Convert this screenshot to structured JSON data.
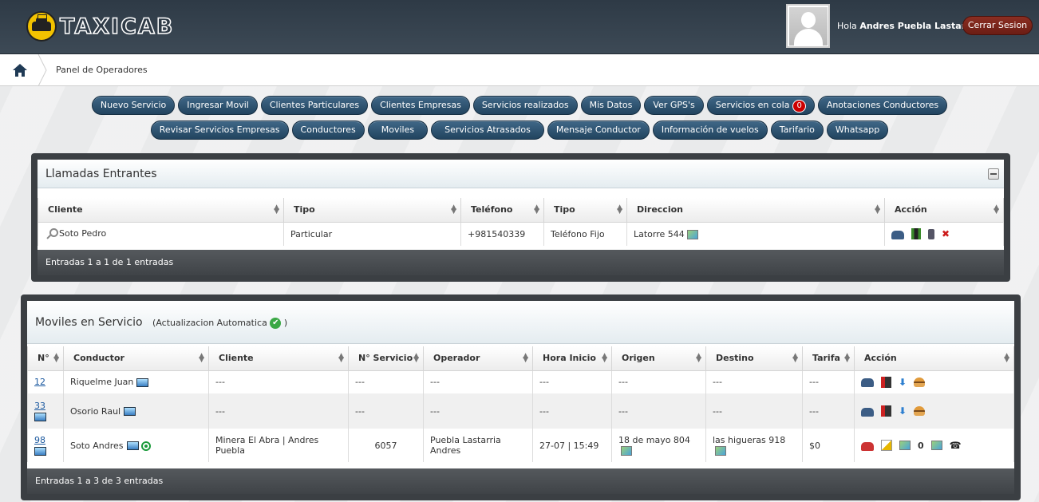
{
  "header": {
    "logo_text": "TAXICAB",
    "greeting_prefix": "Hola",
    "user_name": "Andres Puebla Lastarria",
    "logout_label": "Cerrar Sesion"
  },
  "breadcrumb": {
    "current": "Panel de Operadores"
  },
  "nav": {
    "row1": [
      "Nuevo Servicio",
      "Ingresar Movil",
      "Clientes Particulares",
      "Clientes Empresas",
      "Servicios realizados",
      "Mis Datos",
      "Ver GPS's",
      "Servicios en cola",
      "Anotaciones Conductores"
    ],
    "queue_count": "0",
    "row2": [
      "Revisar Servicios Empresas",
      "Conductores",
      "Moviles",
      "Servicios Atrasados",
      "Mensaje Conductor",
      "Información de vuelos",
      "Tarifario",
      "Whatsapp"
    ]
  },
  "calls": {
    "title": "Llamadas Entrantes",
    "columns": [
      "Cliente",
      "Tipo",
      "Teléfono",
      "Tipo",
      "Direccion",
      "Acción"
    ],
    "rows": [
      {
        "cliente": "Soto Pedro",
        "tipo": "Particular",
        "telefono": "+981540339",
        "tipo2": "Teléfono Fijo",
        "direccion": "Latorre 544"
      }
    ],
    "footer": "Entradas 1 a 1 de 1 entradas"
  },
  "mobiles": {
    "title": "Moviles en Servicio",
    "subtitle_open": "(Actualizacion Automatica",
    "subtitle_close": ")",
    "columns": [
      "N°",
      "Conductor",
      "Cliente",
      "N° Servicio",
      "Operador",
      "Hora Inicio",
      "Origen",
      "Destino",
      "Tarifa",
      "Acción"
    ],
    "rows": [
      {
        "num": "12",
        "conductor": "Riquelme Juan",
        "cliente": "---",
        "servicio": "---",
        "operador": "---",
        "hora": "---",
        "origen": "---",
        "destino": "---",
        "tarifa": "---"
      },
      {
        "num": "33",
        "conductor": "Osorio Raul",
        "cliente": "---",
        "servicio": "---",
        "operador": "---",
        "hora": "---",
        "origen": "---",
        "destino": "---",
        "tarifa": "---"
      },
      {
        "num": "98",
        "conductor": "Soto Andres",
        "cliente": "Minera El Abra | Andres Puebla",
        "servicio": "6057",
        "operador": "Puebla Lastarria Andres",
        "hora": "27-07 | 15:49",
        "origen": "18 de mayo 804",
        "destino": "las higueras 918",
        "tarifa": "$0",
        "counter": "0"
      }
    ],
    "footer": "Entradas 1 a 3 de 3 entradas"
  }
}
